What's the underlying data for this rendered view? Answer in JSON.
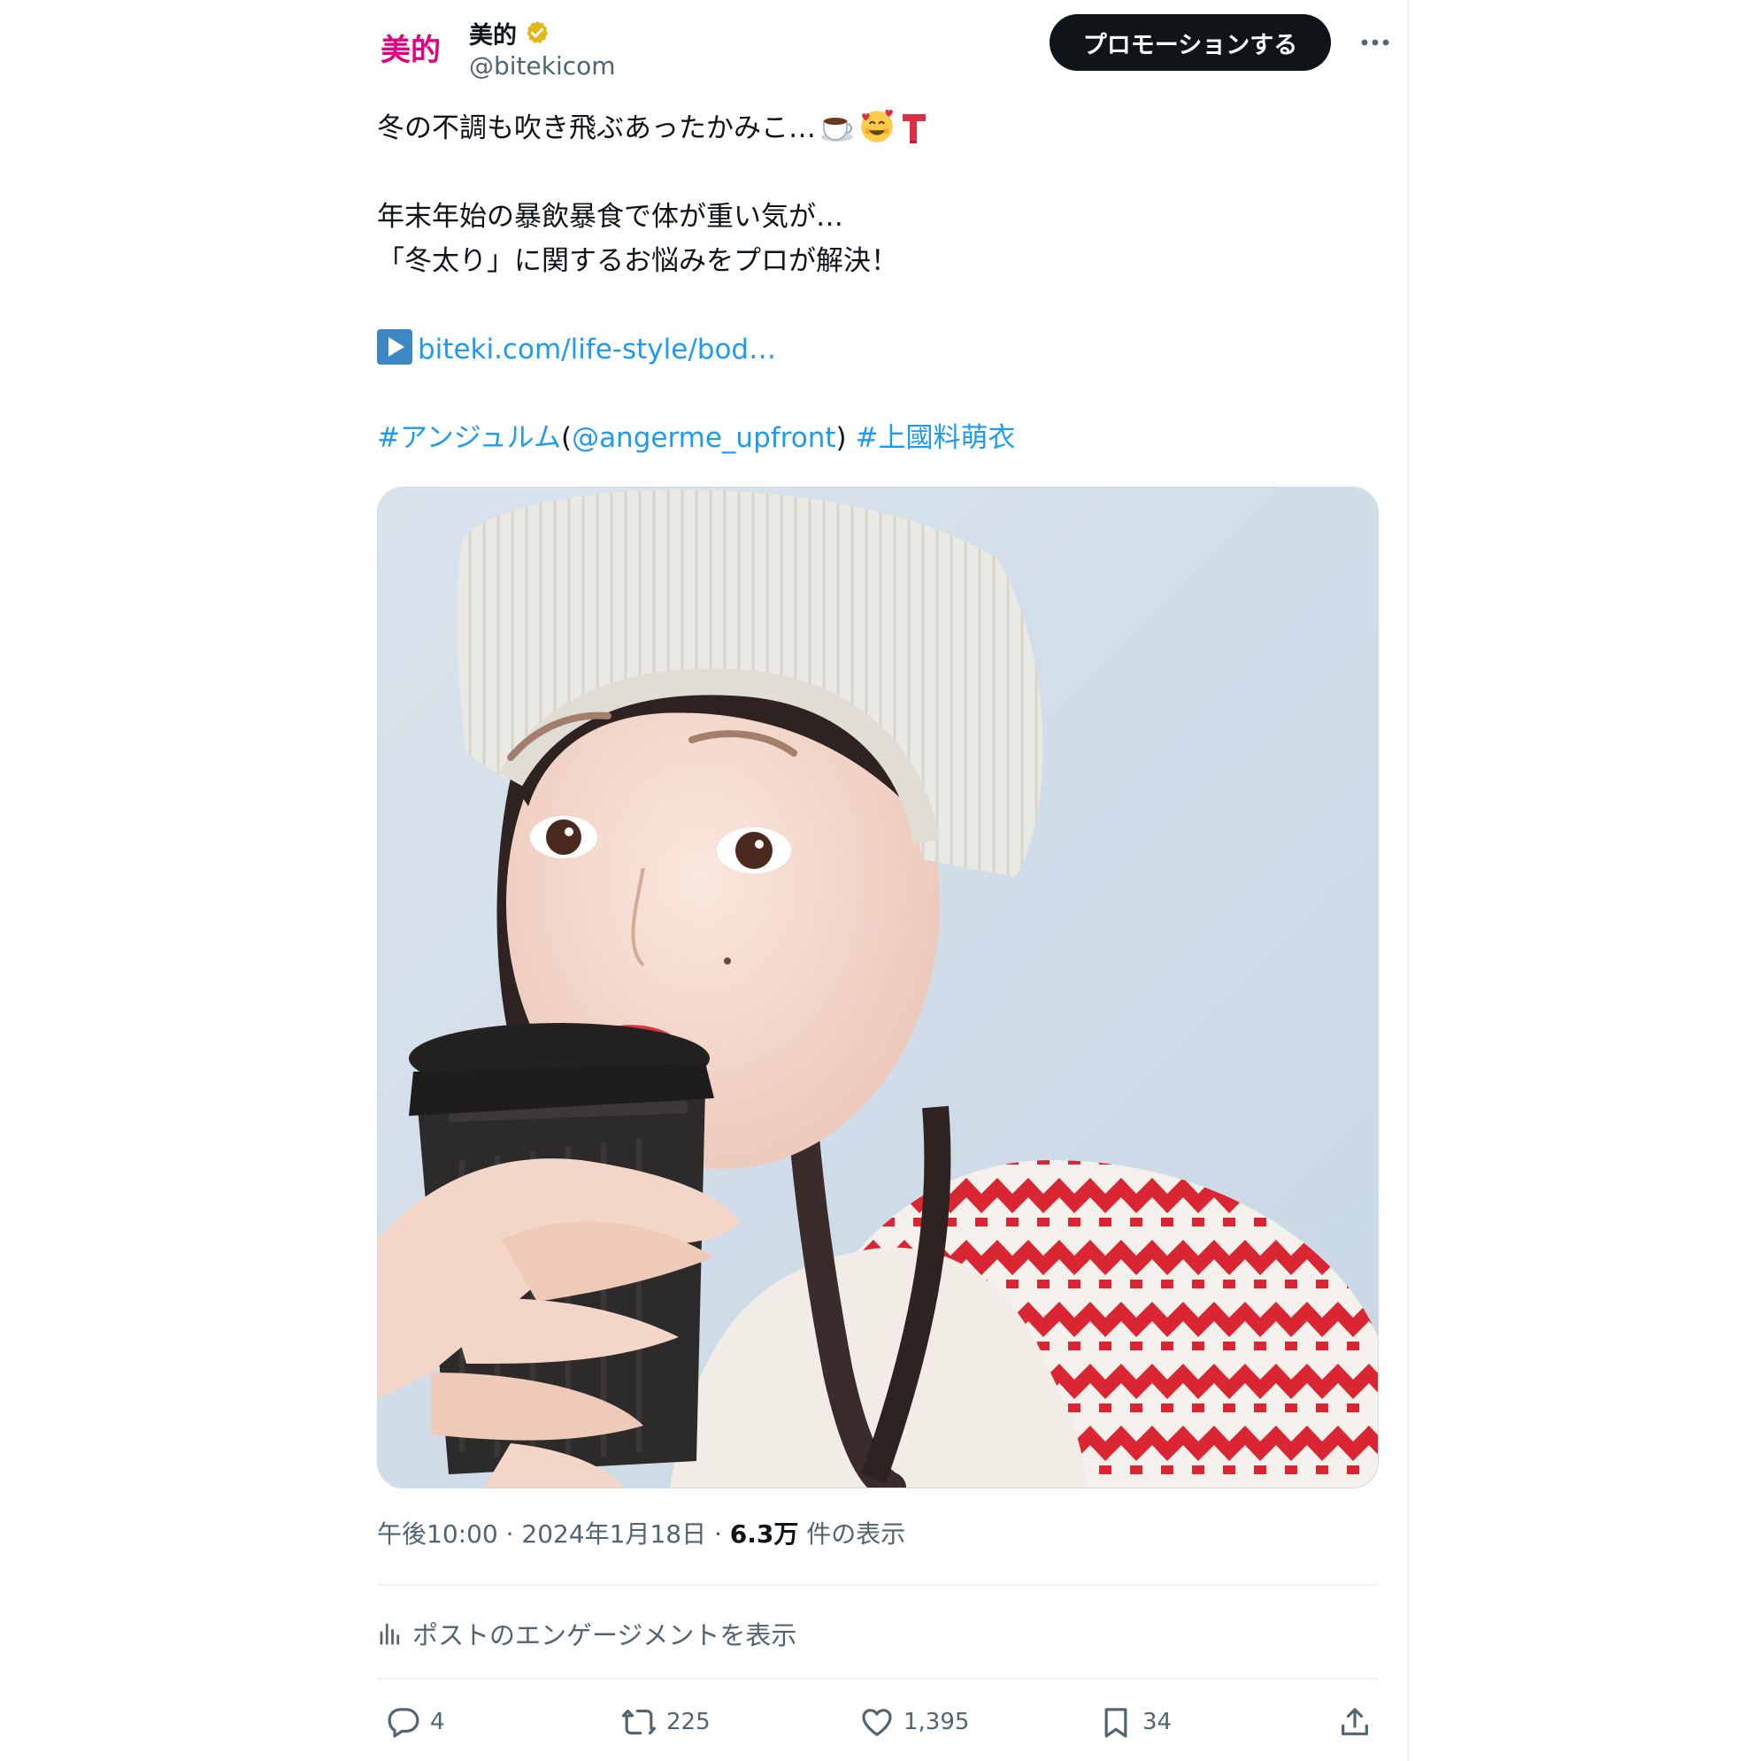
{
  "account": {
    "display_name": "美的",
    "handle": "@bitekicom",
    "avatar_text": "美的",
    "verified": "gold-check-badge"
  },
  "header": {
    "promote_label": "プロモーションする",
    "more_icon": "more-dots-icon"
  },
  "tweet": {
    "line1": "冬の不調も吹き飛ぶあったかみこ…",
    "line1_emojis": [
      "hot-beverage-emoji",
      "smiling-face-with-hearts-emoji",
      "red-scarf-emoji"
    ],
    "line2": "年末年始の暴飲暴食で体が重い気が…",
    "line3": "「冬太り」に関するお悩みをプロが解決！",
    "link_text": "biteki.com/life-style/bod…",
    "hashtag1": "#アンジュルム",
    "paren_open": "(",
    "mention": "@angerme_upfront",
    "paren_close": ")",
    "hashtag2": "#上國料萌衣"
  },
  "media": {
    "kind": "photo"
  },
  "meta": {
    "time_date": "午後10:00 · 2024年1月18日 · ",
    "views_count": "6.3万",
    "views_label": " 件の表示"
  },
  "engagement": {
    "label": "ポストのエンゲージメントを表示",
    "icon": "analytics-icon"
  },
  "actions": {
    "replies": "4",
    "reposts": "225",
    "likes": "1,395",
    "bookmarks": "34"
  },
  "colors": {
    "link": "#1d9bf0",
    "text": "#0f1419",
    "secondary": "#536471",
    "button_bg": "#0f1419",
    "verified": "#e2b719",
    "brand": "#e4007f"
  }
}
